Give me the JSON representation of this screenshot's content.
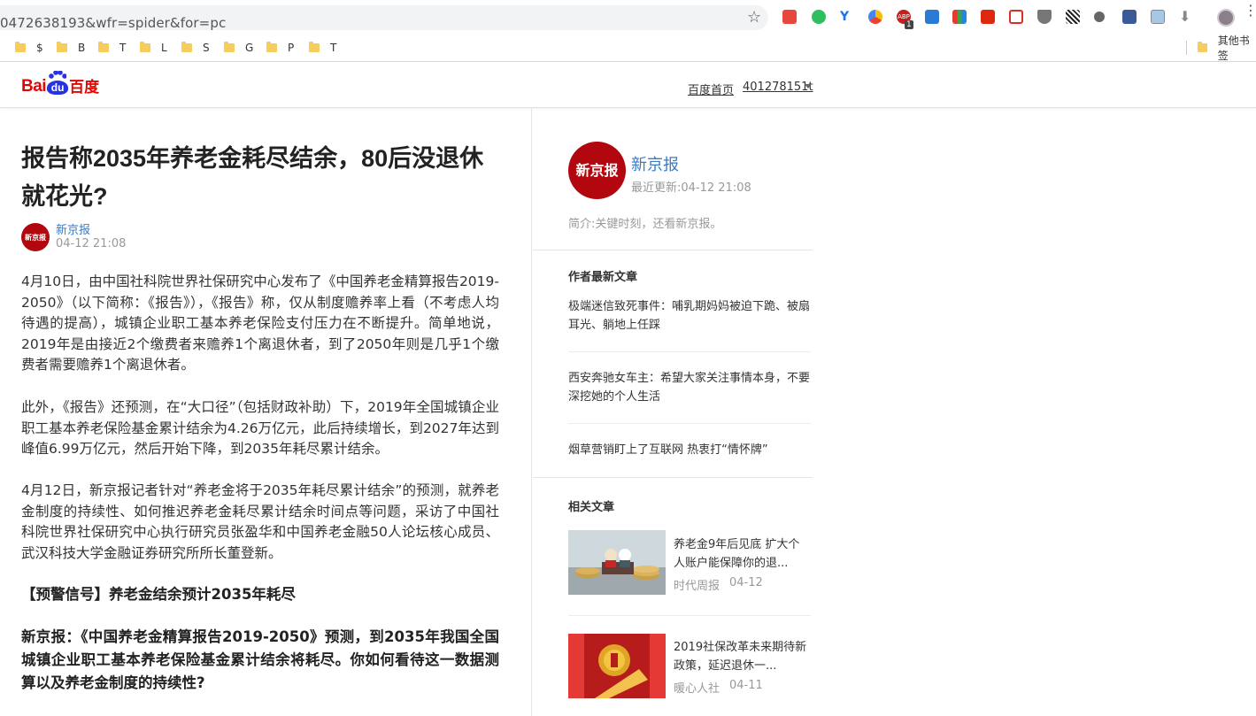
{
  "browser": {
    "url": "0472638193&wfr=spider&for=pc",
    "ext_badge": "1",
    "bookmarks": [
      "$",
      "B",
      "T",
      "L",
      "S",
      "G",
      "P",
      "T"
    ],
    "other_bookmarks": "其他书签"
  },
  "header": {
    "logo": {
      "bai": "Bai",
      "du": "du",
      "cn": "百度"
    },
    "home_link": "百度首页",
    "user": "401278151t"
  },
  "article": {
    "title": "报告称2035年养老金耗尽结余，80后没退休就花光?",
    "author": "新京报",
    "author_logo": "新京报",
    "time": "04-12  21:08",
    "paragraphs": [
      "4月10日，由中国社科院世界社保研究中心发布了《中国养老金精算报告2019-2050》（以下简称：《报告》），《报告》称，仅从制度赡养率上看（不考虑人均待遇的提高），城镇企业职工基本养老保险支付压力在不断提升。简单地说，2019年是由接近2个缴费者来赡养1个离退休者，到了2050年则是几乎1个缴费者需要赡养1个离退休者。",
      "此外，《报告》还预测，在“大口径”（包括财政补助）下，2019年全国城镇企业职工基本养老保险基金累计结余为4.26万亿元，此后持续增长，到2027年达到峰值6.99万亿元，然后开始下降，到2035年耗尽累计结余。",
      "4月12日，新京报记者针对“养老金将于2035年耗尽累计结余”的预测，就养老金制度的持续性、如何推迟养老金耗尽累计结余时间点等问题，采访了中国社科院世界社保研究中心执行研究员张盈华和中国养老金融50人论坛核心成员、武汉科技大学金融证券研究所所长董登新。"
    ],
    "heading1": "【预警信号】养老金结余预计2035年耗尽",
    "question1": "新京报：《中国养老金精算报告2019-2050》预测，到2035年我国全国城镇企业职工基本养老保险基金累计结余将耗尽。你如何看待这一数据测算以及养老金制度的持续性?"
  },
  "sidebar": {
    "author_logo": "新京报",
    "author_name": "新京报",
    "last_update": "最近更新:04-12  21:08",
    "intro": "简介:关键时刻，还看新京报。",
    "latest_title": "作者最新文章",
    "latest": [
      "极端迷信致死事件：哺乳期妈妈被迫下跪、被扇耳光、躺地上任踩",
      "西安奔驰女车主：希望大家关注事情本身，不要深挖她的个人生活",
      "烟草营销盯上了互联网 热衷打“情怀牌”"
    ],
    "related_title": "相关文章",
    "related": [
      {
        "title": "养老金9年后见底 扩大个人账户能保障你的退...",
        "source": "时代周报",
        "date": "04-12"
      },
      {
        "title": "2019社保改革未来期待新政策，延迟退休一...",
        "source": "暖心人社",
        "date": "04-11"
      }
    ]
  }
}
